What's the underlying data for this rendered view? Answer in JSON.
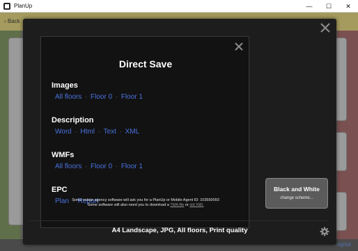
{
  "window": {
    "title": "PlanUp",
    "minimize": "—",
    "maximize": "☐",
    "close": "✕"
  },
  "background": {
    "back_label": "Back",
    "logout_label": "ogout"
  },
  "dialog": {
    "title": "Direct Save",
    "sections": {
      "images": {
        "title": "Images",
        "links": [
          "All floors",
          "Floor 0",
          "Floor 1"
        ]
      },
      "description": {
        "title": "Description",
        "links": [
          "Word",
          "Html",
          "Text",
          "XML"
        ]
      },
      "wmfs": {
        "title": "WMFs",
        "links": [
          "All floors",
          "Floor 0",
          "Floor 1"
        ]
      },
      "epc": {
        "title": "EPC",
        "links": [
          "Plan",
          "Report"
        ]
      }
    },
    "footnote": {
      "line1": "Some estate agency software will ask you for a PlanUp or Mobile Agent ID: 103550093",
      "line2_prefix": "Some software will also need you to download a",
      "tma_link": "TMA file",
      "or": "or",
      "xml_link": "old XML"
    },
    "scheme_button": {
      "label": "Black and White",
      "sub": "change scheme..."
    },
    "summary": "A4 Landscape, JPG, All floors, Print quality"
  },
  "colors": {
    "link": "#4a73e0",
    "modal_bg": "#1d1d1d",
    "panel_bg": "#121212"
  }
}
